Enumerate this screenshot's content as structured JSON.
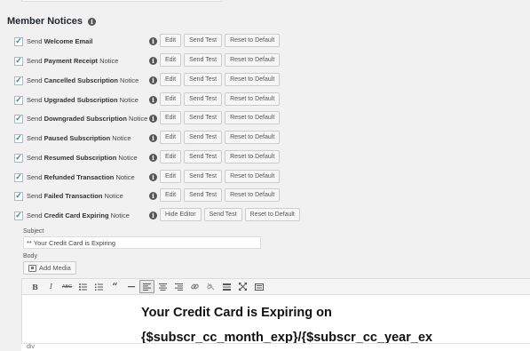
{
  "section": {
    "title": "Member Notices"
  },
  "notices": [
    {
      "prefix": "Send ",
      "bold": "Welcome Email",
      "suffix": "",
      "checked": true,
      "buttons": [
        "Edit",
        "Send Test",
        "Reset to Default"
      ]
    },
    {
      "prefix": "Send ",
      "bold": "Payment Receipt",
      "suffix": " Notice",
      "checked": true,
      "buttons": [
        "Edit",
        "Send Test",
        "Reset to Default"
      ]
    },
    {
      "prefix": "Send ",
      "bold": "Cancelled Subscription",
      "suffix": " Notice",
      "checked": true,
      "buttons": [
        "Edit",
        "Send Test",
        "Reset to Default"
      ]
    },
    {
      "prefix": "Send ",
      "bold": "Upgraded Subscription",
      "suffix": " Notice",
      "checked": true,
      "buttons": [
        "Edit",
        "Send Test",
        "Reset to Default"
      ]
    },
    {
      "prefix": "Send ",
      "bold": "Downgraded Subscription",
      "suffix": " Notice",
      "checked": true,
      "buttons": [
        "Edit",
        "Send Test",
        "Reset to Default"
      ]
    },
    {
      "prefix": "Send ",
      "bold": "Paused Subscription",
      "suffix": " Notice",
      "checked": true,
      "buttons": [
        "Edit",
        "Send Test",
        "Reset to Default"
      ]
    },
    {
      "prefix": "Send ",
      "bold": "Resumed Subscription",
      "suffix": " Notice",
      "checked": true,
      "buttons": [
        "Edit",
        "Send Test",
        "Reset to Default"
      ]
    },
    {
      "prefix": "Send ",
      "bold": "Refunded Transaction",
      "suffix": " Notice",
      "checked": true,
      "buttons": [
        "Edit",
        "Send Test",
        "Reset to Default"
      ]
    },
    {
      "prefix": "Send ",
      "bold": "Failed Transaction",
      "suffix": " Notice",
      "checked": true,
      "buttons": [
        "Edit",
        "Send Test",
        "Reset to Default"
      ]
    },
    {
      "prefix": "Send ",
      "bold": "Credit Card Expiring",
      "suffix": " Notice",
      "checked": true,
      "buttons": [
        "Hide Editor",
        "Send Test",
        "Reset to Default"
      ]
    }
  ],
  "editor": {
    "subject_label": "Subject",
    "subject_value": "** Your Credit Card is Expiring",
    "body_label": "Body",
    "add_media_label": "Add Media",
    "content_line1": "Your Credit Card is Expiring on",
    "content_line2": "{$subscr_cc_month_exp}/{$subscr_cc_year_ex",
    "path": "div",
    "toolbar_icons": [
      "bold-icon",
      "italic-icon",
      "strikethrough-icon",
      "bullet-list-icon",
      "numbered-list-icon",
      "blockquote-icon",
      "horizontal-rule-icon",
      "align-left-icon",
      "align-center-icon",
      "align-right-icon",
      "insert-link-icon",
      "remove-link-icon",
      "read-more-icon",
      "fullscreen-icon",
      "toolbar-toggle-icon"
    ]
  },
  "colors": {
    "checkmark": "#1e8cbe",
    "background": "#f1f1f1"
  }
}
